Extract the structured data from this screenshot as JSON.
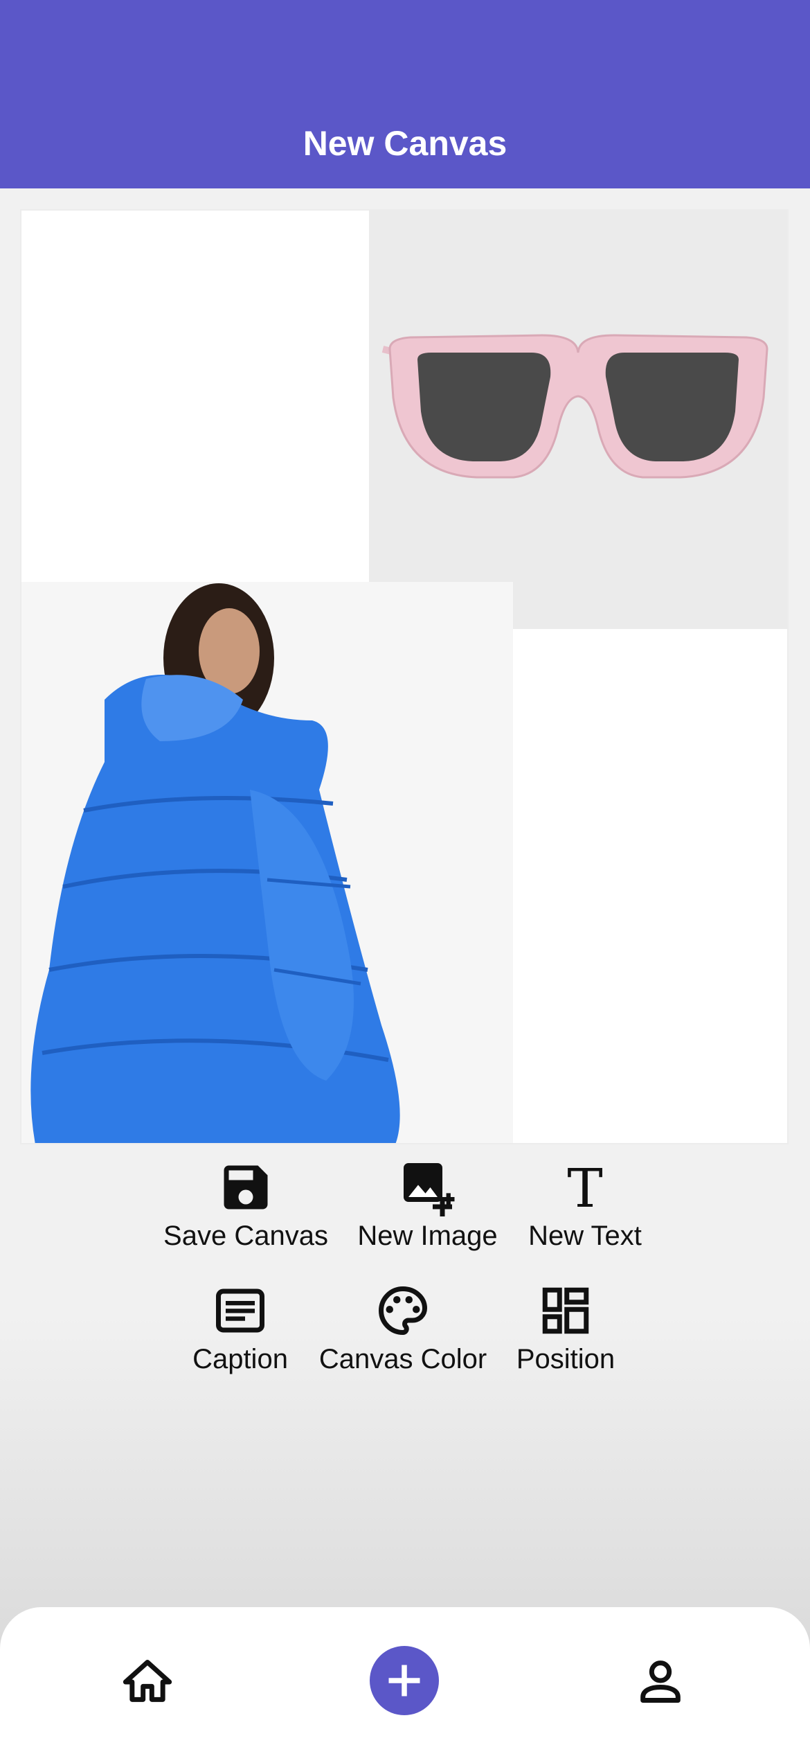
{
  "header": {
    "title": "New Canvas"
  },
  "canvas": {
    "items": [
      {
        "kind": "image",
        "subject": "pink sunglasses"
      },
      {
        "kind": "image",
        "subject": "blue puffer jacket"
      }
    ]
  },
  "toolbar": {
    "save_label": "Save Canvas",
    "new_image_label": "New Image",
    "new_text_label": "New Text",
    "caption_label": "Caption",
    "canvas_color_label": "Canvas Color",
    "position_label": "Position"
  },
  "nav": {
    "icons": [
      "home-icon",
      "add-icon",
      "profile-icon"
    ]
  },
  "colors": {
    "accent": "#5b57c8",
    "background": "#f1f1f1",
    "jacket": "#2f7be6",
    "sunglasses_frame": "#efc6d1"
  }
}
